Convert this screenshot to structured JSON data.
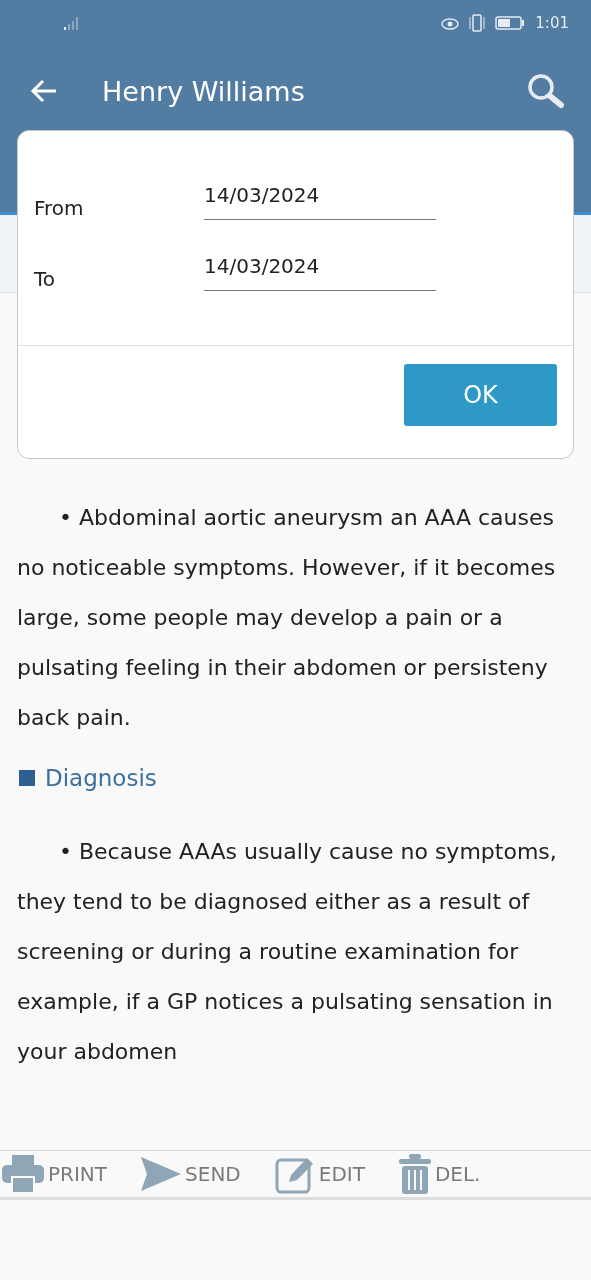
{
  "status_bar": {
    "time": "1:01"
  },
  "app_bar": {
    "title": "Henry Williams"
  },
  "date_dialog": {
    "fields": [
      {
        "label": "From",
        "value": "14/03/2024"
      },
      {
        "label": "To",
        "value": "14/03/2024"
      }
    ],
    "ok_button": "OK"
  },
  "content": [
    {
      "kind": "paragraph",
      "text": "• Abdominal aortic aneurysm an AAA causes no noticeable symptoms. However, if it becomes large, some people may develop a pain or a pulsating feeling in their abdomen or persisteny back pain."
    },
    {
      "kind": "heading",
      "text": "Diagnosis"
    },
    {
      "kind": "paragraph",
      "text": "• Because AAAs usually cause no symptoms, they tend to be diagnosed either as a result of screening or during a routine examination for example, if a GP notices a pulsating sensation in your abdomen"
    }
  ],
  "toolbar": [
    {
      "kind": "print",
      "label": "PRINT"
    },
    {
      "kind": "send",
      "label": "SEND"
    },
    {
      "kind": "edit",
      "label": "EDIT"
    },
    {
      "kind": "delete",
      "label": "DEL."
    }
  ]
}
